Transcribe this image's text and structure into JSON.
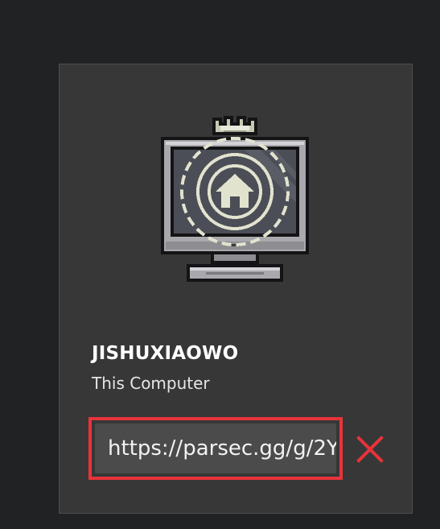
{
  "host": {
    "name": "JISHUXIAOWO",
    "subtitle": "This Computer",
    "icon": "pixel-monitor-home-icon"
  },
  "share_link": {
    "value": "https://parsec.gg/g/2Y"
  },
  "actions": {
    "close_icon": "close-icon"
  },
  "colors": {
    "background": "#212223",
    "card": "#373737",
    "highlight_border": "#e8333a",
    "close": "#e8333a"
  }
}
